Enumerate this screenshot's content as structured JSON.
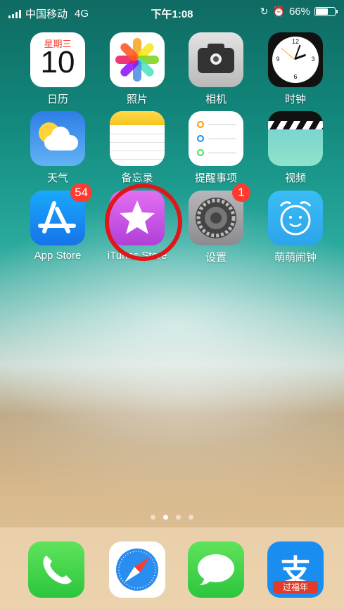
{
  "status_bar": {
    "carrier": "中国移动",
    "network": "4G",
    "time": "下午1:08",
    "battery_percent": "66%",
    "battery_level": 0.66
  },
  "apps": [
    {
      "label": "日历",
      "icon": "calendar-icon",
      "weekday": "星期三",
      "date": "10"
    },
    {
      "label": "照片",
      "icon": "photos-icon"
    },
    {
      "label": "相机",
      "icon": "camera-icon"
    },
    {
      "label": "时钟",
      "icon": "clock-icon"
    },
    {
      "label": "天气",
      "icon": "weather-icon"
    },
    {
      "label": "备忘录",
      "icon": "notes-icon"
    },
    {
      "label": "提醒事项",
      "icon": "reminders-icon"
    },
    {
      "label": "视频",
      "icon": "videos-icon"
    },
    {
      "label": "App Store",
      "icon": "app-store-icon",
      "badge": "54"
    },
    {
      "label": "iTunes Store",
      "icon": "itunes-store-icon"
    },
    {
      "label": "设置",
      "icon": "settings-icon",
      "badge": "1"
    },
    {
      "label": "萌萌闹钟",
      "icon": "alarm-clock-app-icon"
    }
  ],
  "page_dots": {
    "count": 4,
    "active": 1
  },
  "dock": [
    {
      "icon": "phone-icon"
    },
    {
      "icon": "safari-icon"
    },
    {
      "icon": "messages-icon"
    },
    {
      "icon": "alipay-icon",
      "caption": "过福年",
      "glyph": "支"
    }
  ],
  "colors": {
    "highlight": "#e0171a",
    "badge": "#ff3b30"
  }
}
